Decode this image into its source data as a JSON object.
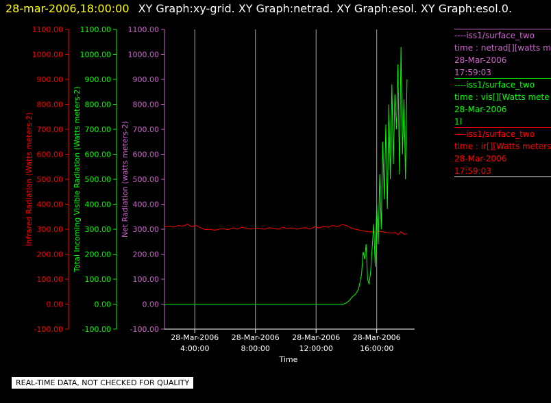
{
  "header": {
    "date": "28-mar-2006,18:00:00",
    "titles": "XY Graph:xy-grid.  XY Graph:netrad.  XY Graph:esol.  XY Graph:esol.0."
  },
  "legend": {
    "netrad": {
      "source": "----iss1/surface_two",
      "field": "time : netrad[][watts me",
      "date": "28-Mar-2006",
      "time": "17:59:03"
    },
    "vis": {
      "source": "----iss1/surface_two",
      "field": "time : vis[][Watts mete",
      "date": "28-Mar-2006",
      "time": "1l"
    },
    "ir": {
      "source": "----iss1/surface_two",
      "field": "time : ir[][Watts meters",
      "date": "28-Mar-2006",
      "time": "17:59:03"
    }
  },
  "note": "REAL-TIME DATA, NOT CHECKED FOR QUALITY",
  "colors": {
    "red": "#ff0000",
    "green": "#00ff00",
    "violet": "#cc66cc",
    "grid": "#aaaaaa",
    "white": "#ffffff"
  },
  "chart_data": {
    "type": "line",
    "xlabel": "Time",
    "x_ticks": [
      {
        "t": 4,
        "date": "28-Mar-2006",
        "time": "4:00:00"
      },
      {
        "t": 8,
        "date": "28-Mar-2006",
        "time": "8:00:00"
      },
      {
        "t": 12,
        "date": "28-Mar-2006",
        "time": "12:00:00"
      },
      {
        "t": 16,
        "date": "28-Mar-2006",
        "time": "16:00:00"
      }
    ],
    "xlim": [
      2.0,
      18.5
    ],
    "grid": true,
    "y_axes": [
      {
        "id": "ir",
        "label": "Infrared Radiation (Watts meters-2)",
        "color": "#ff0000",
        "ylim": [
          -100,
          1100
        ]
      },
      {
        "id": "vis",
        "label": "Total Incoming Visible Radiation (Watts meters-2)",
        "color": "#00ff00",
        "ylim": [
          -100,
          1100
        ]
      },
      {
        "id": "net",
        "label": "Net Radiation (watts meters-2)",
        "color": "#cc66cc",
        "ylim": [
          -100,
          1100
        ]
      }
    ],
    "y_ticks": [
      -100,
      0,
      100,
      200,
      300,
      400,
      500,
      600,
      700,
      800,
      900,
      1000,
      1100
    ],
    "y_tick_labels": [
      "-100.00",
      "0.00",
      "100.00",
      "200.00",
      "300.00",
      "400.00",
      "500.00",
      "600.00",
      "700.00",
      "800.00",
      "900.00",
      "1000.00",
      "1100.00"
    ],
    "series": [
      {
        "axis": "ir",
        "color": "#ff0000",
        "x": [
          2.0,
          2.3,
          2.6,
          2.9,
          3.2,
          3.5,
          3.8,
          4.1,
          4.4,
          4.7,
          5.0,
          5.3,
          5.6,
          5.9,
          6.2,
          6.5,
          6.8,
          7.1,
          7.4,
          7.7,
          8.0,
          8.3,
          8.6,
          8.9,
          9.2,
          9.5,
          9.8,
          10.1,
          10.4,
          10.7,
          11.0,
          11.3,
          11.6,
          11.9,
          12.2,
          12.5,
          12.8,
          13.1,
          13.4,
          13.7,
          14.0,
          14.3,
          14.6,
          14.9,
          15.2,
          15.5,
          15.8,
          16.1,
          16.4,
          16.7,
          17.0,
          17.2,
          17.4,
          17.6,
          17.8,
          18.0
        ],
        "y": [
          310,
          312,
          308,
          315,
          312,
          320,
          310,
          315,
          305,
          298,
          300,
          296,
          300,
          302,
          298,
          305,
          300,
          308,
          304,
          300,
          305,
          302,
          300,
          306,
          303,
          300,
          308,
          302,
          305,
          300,
          304,
          306,
          300,
          310,
          305,
          312,
          308,
          315,
          310,
          318,
          315,
          305,
          300,
          296,
          292,
          290,
          288,
          292,
          290,
          286,
          284,
          288,
          278,
          290,
          280,
          282
        ]
      },
      {
        "axis": "vis",
        "color": "#00ff00",
        "x": [
          2.0,
          6.0,
          10.0,
          13.0,
          13.8,
          14.0,
          14.2,
          14.4,
          14.6,
          14.8,
          15.0,
          15.1,
          15.2,
          15.3,
          15.4,
          15.5,
          15.6,
          15.8,
          15.9,
          16.0,
          16.1,
          16.2,
          16.3,
          16.4,
          16.5,
          16.6,
          16.7,
          16.8,
          16.9,
          17.0,
          17.1,
          17.2,
          17.3,
          17.4,
          17.5,
          17.6,
          17.7,
          17.8,
          17.9,
          18.0
        ],
        "y": [
          0,
          0,
          0,
          0,
          0,
          5,
          15,
          30,
          40,
          60,
          120,
          210,
          180,
          240,
          100,
          80,
          130,
          320,
          150,
          400,
          240,
          520,
          300,
          650,
          420,
          720,
          380,
          800,
          500,
          880,
          560,
          840,
          700,
          960,
          520,
          1030,
          600,
          820,
          500,
          900
        ]
      }
    ]
  }
}
